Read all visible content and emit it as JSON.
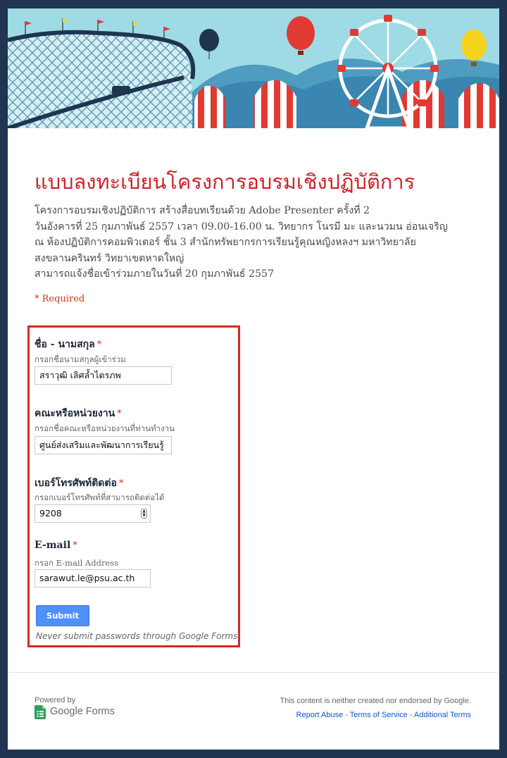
{
  "form": {
    "title": "แบบลงทะเบียนโครงการอบรมเชิงปฏิบัติการ",
    "description_lines": [
      "โครงการอบรมเชิงปฏิบัติการ สร้างสื่อบทเรียนด้วย Adobe Presenter ครั้งที่ 2",
      "วันอังคารที่ 25 กุมภาพันธ์ 2557 เวลา 09.00-16.00 น. วิทยากร โนรมี มะ และนวมน อ่อนเจริญ",
      "ณ ห้องปฏิบัติการคอมพิวเตอร์ ชั้น 3 สำนักทรัพยากรการเรียนรู้คุณหญิงหลงฯ มหาวิทยาลัย",
      "สงขลานครินทร์ วิทยาเขตหาดใหญ่",
      "สามารถแจ้งชื่อเข้าร่วมภายในวันที่ 20 กุมภาพันธ์ 2557"
    ],
    "required_note": "* Required",
    "questions": [
      {
        "title": "ชื่อ - นามสกุล",
        "required_mark": "*",
        "help": "กรอกชื่อนามสกุลผู้เข้าร่วม",
        "value": "สราวุฒิ เลิศล้ำไตรภพ"
      },
      {
        "title": "คณะหรือหน่วยงาน",
        "required_mark": "*",
        "help": "กรอกชื่อคณะหรือหน่วยงานที่ท่านทำงาน",
        "value": "ศูนย์ส่งเสริมและพัฒนาการเรียนรู้"
      },
      {
        "title": "เบอร์โทรศัพท์ติดต่อ",
        "required_mark": "*",
        "help": "กรอกเบอร์โทรศัพท์ที่สามารถติดต่อได้",
        "value": "9208"
      },
      {
        "title": "E-mail",
        "required_mark": "*",
        "help": "กรอก E-mail Address",
        "value": "sarawut.le@psu.ac.th"
      }
    ],
    "submit_label": "Submit",
    "password_warning": "Never submit passwords through Google Forms."
  },
  "footer": {
    "powered_by": "Powered by",
    "brand": "Google Forms",
    "disclaimer": "This content is neither created nor endorsed by Google.",
    "links": [
      "Report Abuse",
      "Terms of Service",
      "Additional Terms"
    ],
    "separator": " - "
  },
  "colors": {
    "title": "#cc2229",
    "highlight_border": "#d22b25",
    "submit": "#4d90fe",
    "link": "#1155cc",
    "page_background": "#1f3552"
  },
  "icons": {
    "banner": "carnival-illustration",
    "logo": "google-forms-icon",
    "spinner": "number-spinner-icon"
  }
}
